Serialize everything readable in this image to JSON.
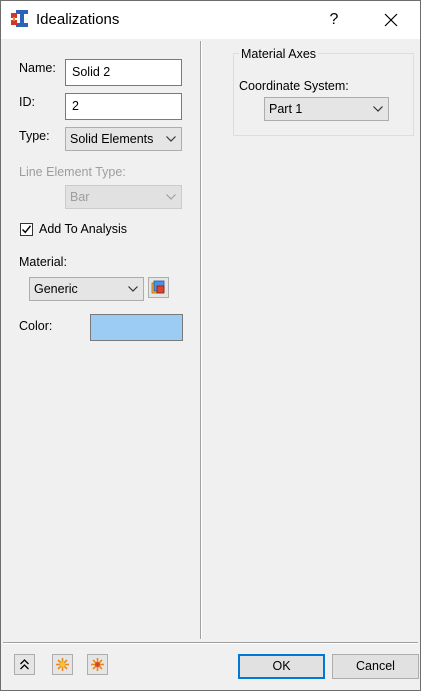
{
  "window": {
    "title": "Idealizations",
    "help_label": "?"
  },
  "left_panel": {
    "name_label": "Name:",
    "name_value": "Solid 2",
    "id_label": "ID:",
    "id_value": "2",
    "type_label": "Type:",
    "type_value": "Solid Elements",
    "line_element_type_label": "Line Element Type:",
    "line_element_type_value": "Bar",
    "add_to_analysis_label": "Add To Analysis",
    "add_to_analysis_checked": true,
    "material_label": "Material:",
    "material_value": "Generic",
    "color_label": "Color:",
    "color_value": "#9ccbf4"
  },
  "right_panel": {
    "group_title": "Material Axes",
    "coord_label": "Coordinate System:",
    "coord_value": "Part 1"
  },
  "footer": {
    "ok_label": "OK",
    "cancel_label": "Cancel"
  },
  "icons": [
    "app-icon",
    "close-icon",
    "chevron-down-icon",
    "material-browser-icon",
    "collapse-icon",
    "create-icon",
    "edit-icon"
  ],
  "colors": {
    "accent": "#0078d7",
    "color_swatch": "#9ccbf4",
    "disabled_text": "#9d9d9d"
  }
}
